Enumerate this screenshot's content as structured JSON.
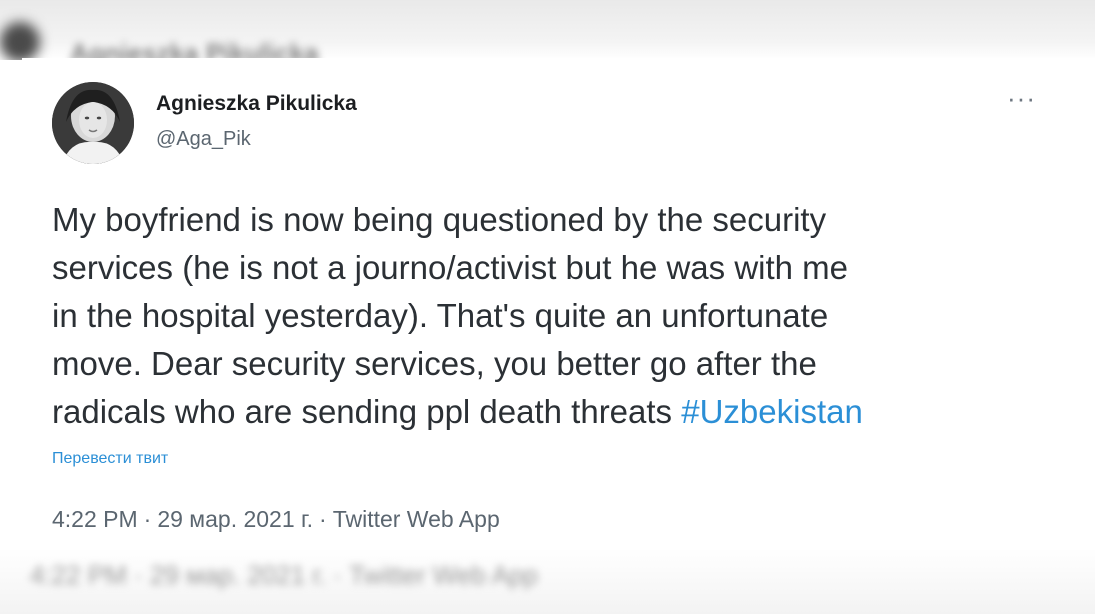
{
  "background": {
    "top_ghost_text": "Agnieszka Pikulicka",
    "bottom_ghost_text": "4:22 PM · 29 мар. 2021 г. · Twitter Web App"
  },
  "tweet": {
    "author": {
      "display_name": "Agnieszka Pikulicka",
      "handle": "@Aga_Pik",
      "avatar_icon": "profile-photo-icon"
    },
    "more_icon": "more-options-icon",
    "text": "My boyfriend is now being questioned by the security\nservices (he is not a journo/activist but he was with me\nin the hospital yesterday). That's quite an unfortunate\nmove. Dear security services, you better go after the\nradicals who are sending ppl death threats ",
    "hashtag": "#Uzbekistan",
    "translate_label": "Перевести твит",
    "time": "4:22 PM",
    "date": "29 мар. 2021 г.",
    "source": "Twitter Web App",
    "separator": "·"
  },
  "colors": {
    "link": "#2b8fd6",
    "text": "#2b3035",
    "muted": "#5b6670"
  }
}
